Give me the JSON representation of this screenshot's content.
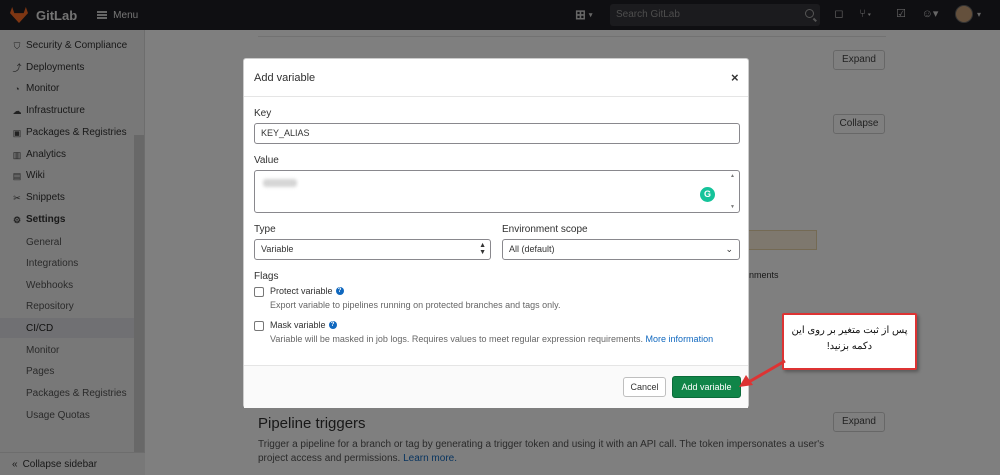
{
  "topbar": {
    "logo_text": "GitLab",
    "menu_label": "Menu",
    "search_placeholder": "Search GitLab"
  },
  "sidebar": {
    "items": [
      {
        "label": "Security & Compliance",
        "icon": "shield-icon"
      },
      {
        "label": "Deployments",
        "icon": "rocket-icon"
      },
      {
        "label": "Monitor",
        "icon": "monitor-icon"
      },
      {
        "label": "Infrastructure",
        "icon": "cloud-icon"
      },
      {
        "label": "Packages & Registries",
        "icon": "package-icon"
      },
      {
        "label": "Analytics",
        "icon": "chart-icon"
      },
      {
        "label": "Wiki",
        "icon": "book-icon"
      },
      {
        "label": "Snippets",
        "icon": "scissors-icon"
      },
      {
        "label": "Settings",
        "icon": "gear-icon"
      }
    ],
    "settings_sub": [
      "General",
      "Integrations",
      "Webhooks",
      "Repository",
      "CI/CD",
      "Monitor",
      "Pages",
      "Packages & Registries",
      "Usage Quotas"
    ],
    "active_sub": "CI/CD",
    "collapse_label": "Collapse sidebar"
  },
  "background": {
    "expand_label": "Expand",
    "collapse_label": "Collapse",
    "comments_fragment": "nments",
    "section_title": "Pipeline triggers",
    "section_desc": "Trigger a pipeline for a branch or tag by generating a trigger token and using it with an API call. The token impersonates a user's project access and permissions.",
    "learn_more": "Learn more."
  },
  "modal": {
    "title": "Add variable",
    "close_symbol": "×",
    "key_label": "Key",
    "key_value": "KEY_ALIAS",
    "value_label": "Value",
    "type_label": "Type",
    "type_value": "Variable",
    "env_label": "Environment scope",
    "env_value": "All (default)",
    "flags_label": "Flags",
    "protect_label": "Protect variable",
    "protect_help": "Export variable to pipelines running on protected branches and tags only.",
    "protect_checked": false,
    "mask_label": "Mask variable",
    "mask_help": "Variable will be masked in job logs. Requires values to meet regular expression requirements.",
    "mask_more": "More information",
    "mask_checked": false,
    "cancel_label": "Cancel",
    "add_label": "Add variable"
  },
  "annotation": {
    "line1": "پس از ثبت متغیر بر روی این",
    "line2": "دکمه بزنید!",
    "border_color": "#dd3333"
  }
}
